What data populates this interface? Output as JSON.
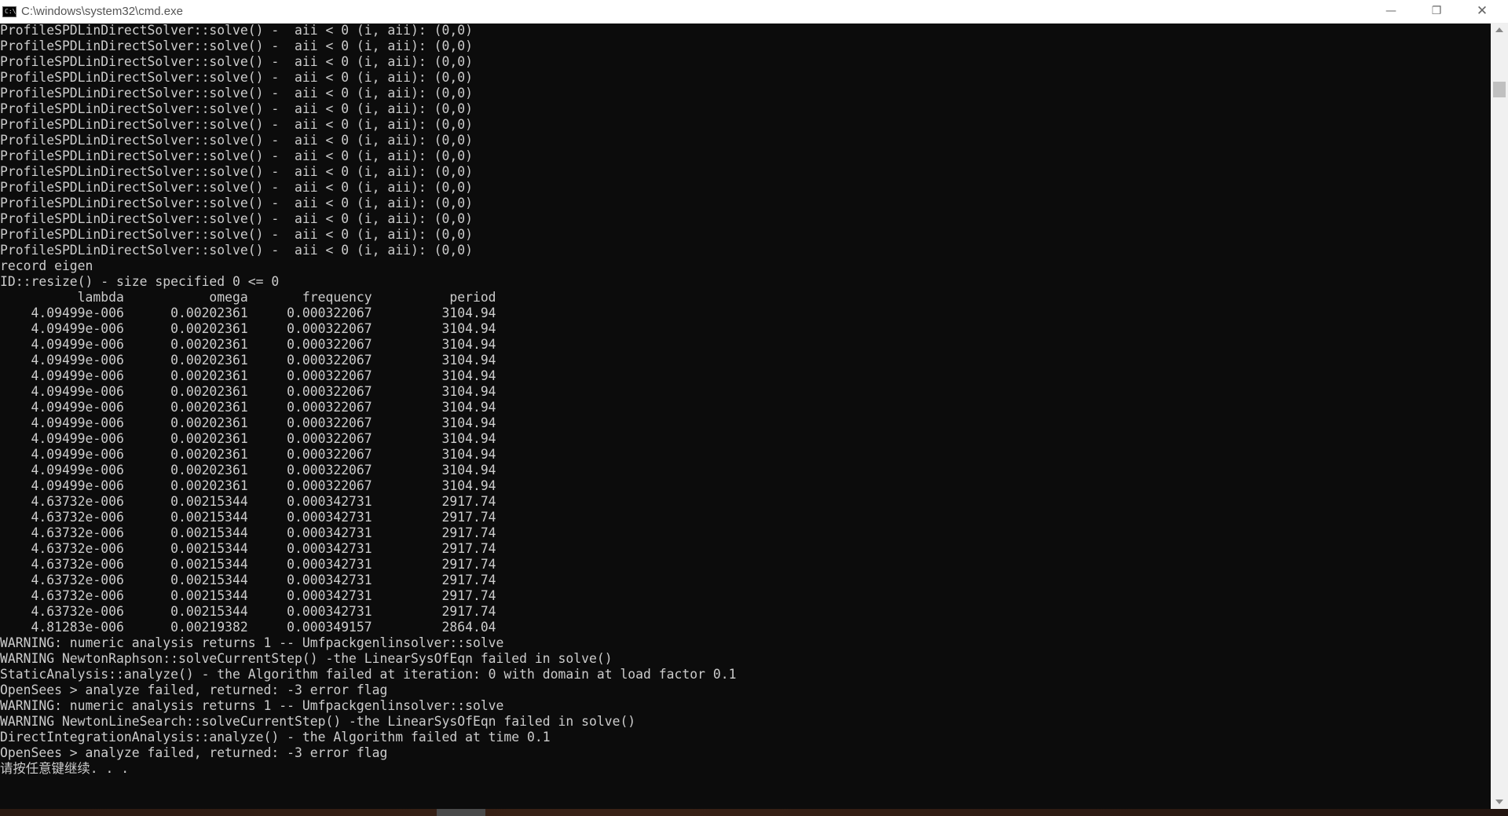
{
  "window": {
    "title": "C:\\windows\\system32\\cmd.exe",
    "icon": "cmd-icon",
    "icon_text": "C:\\",
    "controls": {
      "minimize": "—",
      "restore": "❐",
      "close": "✕"
    }
  },
  "console": {
    "text_color": "#cccccc",
    "background": "#0c0c0c",
    "lines": [
      "ProfileSPDLinDirectSolver::solve() -  aii < 0 (i, aii): (0,0)",
      "ProfileSPDLinDirectSolver::solve() -  aii < 0 (i, aii): (0,0)",
      "ProfileSPDLinDirectSolver::solve() -  aii < 0 (i, aii): (0,0)",
      "ProfileSPDLinDirectSolver::solve() -  aii < 0 (i, aii): (0,0)",
      "ProfileSPDLinDirectSolver::solve() -  aii < 0 (i, aii): (0,0)",
      "ProfileSPDLinDirectSolver::solve() -  aii < 0 (i, aii): (0,0)",
      "ProfileSPDLinDirectSolver::solve() -  aii < 0 (i, aii): (0,0)",
      "ProfileSPDLinDirectSolver::solve() -  aii < 0 (i, aii): (0,0)",
      "ProfileSPDLinDirectSolver::solve() -  aii < 0 (i, aii): (0,0)",
      "ProfileSPDLinDirectSolver::solve() -  aii < 0 (i, aii): (0,0)",
      "ProfileSPDLinDirectSolver::solve() -  aii < 0 (i, aii): (0,0)",
      "ProfileSPDLinDirectSolver::solve() -  aii < 0 (i, aii): (0,0)",
      "ProfileSPDLinDirectSolver::solve() -  aii < 0 (i, aii): (0,0)",
      "ProfileSPDLinDirectSolver::solve() -  aii < 0 (i, aii): (0,0)",
      "ProfileSPDLinDirectSolver::solve() -  aii < 0 (i, aii): (0,0)",
      "record eigen",
      "ID::resize() - size specified 0 <= 0",
      "          lambda           omega       frequency          period",
      "    4.09499e-006      0.00202361     0.000322067         3104.94",
      "    4.09499e-006      0.00202361     0.000322067         3104.94",
      "    4.09499e-006      0.00202361     0.000322067         3104.94",
      "    4.09499e-006      0.00202361     0.000322067         3104.94",
      "    4.09499e-006      0.00202361     0.000322067         3104.94",
      "    4.09499e-006      0.00202361     0.000322067         3104.94",
      "    4.09499e-006      0.00202361     0.000322067         3104.94",
      "    4.09499e-006      0.00202361     0.000322067         3104.94",
      "    4.09499e-006      0.00202361     0.000322067         3104.94",
      "    4.09499e-006      0.00202361     0.000322067         3104.94",
      "    4.09499e-006      0.00202361     0.000322067         3104.94",
      "    4.09499e-006      0.00202361     0.000322067         3104.94",
      "    4.63732e-006      0.00215344     0.000342731         2917.74",
      "    4.63732e-006      0.00215344     0.000342731         2917.74",
      "    4.63732e-006      0.00215344     0.000342731         2917.74",
      "    4.63732e-006      0.00215344     0.000342731         2917.74",
      "    4.63732e-006      0.00215344     0.000342731         2917.74",
      "    4.63732e-006      0.00215344     0.000342731         2917.74",
      "    4.63732e-006      0.00215344     0.000342731         2917.74",
      "    4.63732e-006      0.00215344     0.000342731         2917.74",
      "    4.81283e-006      0.00219382     0.000349157         2864.04",
      "WARNING: numeric analysis returns 1 -- Umfpackgenlinsolver::solve",
      "WARNING NewtonRaphson::solveCurrentStep() -the LinearSysOfEqn failed in solve()",
      "StaticAnalysis::analyze() - the Algorithm failed at iteration: 0 with domain at load factor 0.1",
      "OpenSees > analyze failed, returned: -3 error flag",
      "WARNING: numeric analysis returns 1 -- Umfpackgenlinsolver::solve",
      "WARNING NewtonLineSearch::solveCurrentStep() -the LinearSysOfEqn failed in solve()",
      "DirectIntegrationAnalysis::analyze() - the Algorithm failed at time 0.1",
      "OpenSees > analyze failed, returned: -3 error flag",
      "请按任意键继续. . ."
    ]
  }
}
